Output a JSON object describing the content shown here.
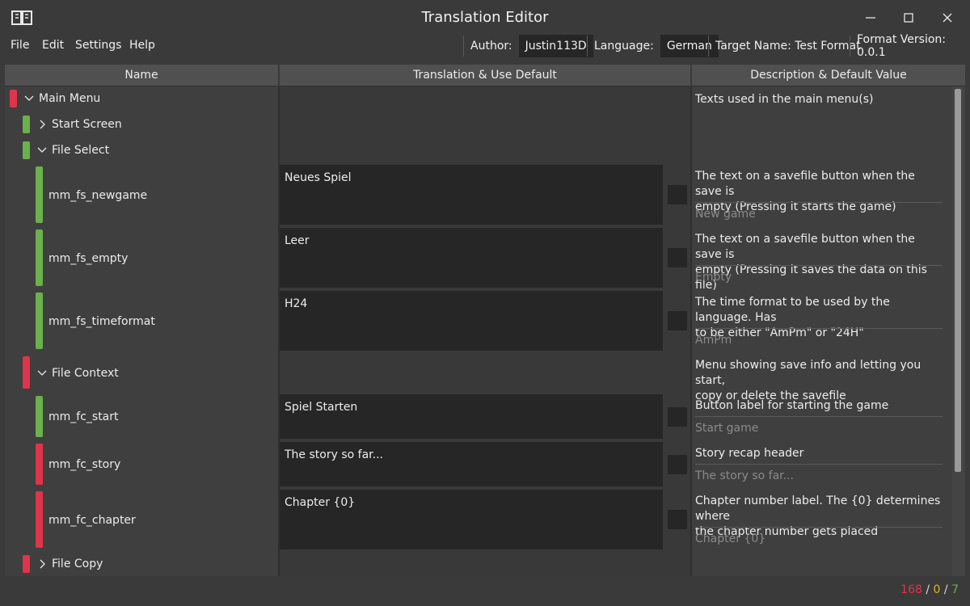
{
  "window": {
    "title": "Translation Editor"
  },
  "menu": [
    "File",
    "Edit",
    "Settings",
    "Help"
  ],
  "meta": {
    "author_label": "Author:",
    "author_value": "Justin113D",
    "language_label": "Language:",
    "language_value": "German",
    "target_name": "Target Name: Test Format",
    "format_version": "Format Version: 0.0.1"
  },
  "columns": {
    "name": "Name",
    "translation": "Translation & Use Default",
    "description": "Description & Default Value"
  },
  "tree": {
    "main_menu": {
      "name": "Main Menu",
      "description": "Texts used in the main menu(s)",
      "status": "red",
      "expanded": true
    },
    "start_screen": {
      "name": "Start Screen",
      "status": "green",
      "expanded": false
    },
    "file_select": {
      "name": "File Select",
      "status": "green",
      "expanded": true
    },
    "file_context": {
      "name": "File Context",
      "description_line1": "Menu showing save info and letting you start,",
      "description_line2": "copy or delete the savefile",
      "status": "red",
      "expanded": true
    },
    "file_copy": {
      "name": "File Copy",
      "status": "red",
      "expanded": false
    }
  },
  "entries": [
    {
      "key": "mm_fs_newgame",
      "translation": "Neues Spiel",
      "desc1": "The text on a savefile button when the save is",
      "desc2": "empty (Pressing it starts the game)",
      "default": "New game",
      "status": "green",
      "use_default": false
    },
    {
      "key": "mm_fs_empty",
      "translation": "Leer",
      "desc1": "The text on a savefile button when the save is",
      "desc2": "empty (Pressing it saves the data on this file)",
      "default": "Empty",
      "status": "green",
      "use_default": false
    },
    {
      "key": "mm_fs_timeformat",
      "translation": "H24",
      "desc1": "The time format to be used by the language. Has",
      "desc2": "to be either \"AmPm\" or \"24H\"",
      "default": "AmPm",
      "status": "green",
      "use_default": false
    },
    {
      "key": "mm_fc_start",
      "translation": "Spiel Starten",
      "desc1": "Button label for starting the game",
      "desc2": "",
      "default": "Start game",
      "status": "green",
      "use_default": false
    },
    {
      "key": "mm_fc_story",
      "translation": "The story so far...",
      "desc1": "Story recap header",
      "desc2": "",
      "default": "The story so far...",
      "status": "red",
      "use_default": false
    },
    {
      "key": "mm_fc_chapter",
      "translation": "Chapter {0}",
      "desc1": "Chapter number label. The {0} determines where",
      "desc2": "the chapter number gets placed",
      "default": "Chapter {0}",
      "status": "red",
      "use_default": false
    }
  ],
  "status": {
    "red_count": "168",
    "sep1": " / ",
    "yellow_count": "0",
    "sep2": " / ",
    "green_count": "7"
  },
  "colors": {
    "green": "#6ab04c",
    "red": "#e0344a",
    "yellow": "#e0b030"
  }
}
